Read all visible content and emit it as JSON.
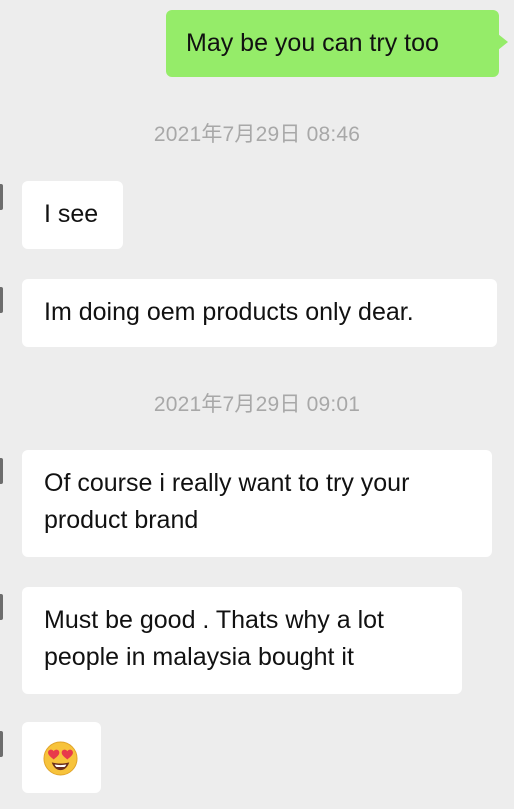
{
  "messages": [
    {
      "type": "outgoing",
      "text": "May be you can try too"
    },
    {
      "type": "timestamp",
      "text": "2021年7月29日 08:46"
    },
    {
      "type": "incoming",
      "text": "I see"
    },
    {
      "type": "incoming",
      "text": "Im doing oem products only dear."
    },
    {
      "type": "timestamp",
      "text": "2021年7月29日 09:01"
    },
    {
      "type": "incoming",
      "text": "Of course i really want to try your product brand"
    },
    {
      "type": "incoming",
      "text": "Must be good . Thats why a lot people in malaysia bought it"
    },
    {
      "type": "incoming_emoji",
      "icon": "heart-eyes-emoji"
    }
  ],
  "colors": {
    "background": "#ededed",
    "outgoing_bubble": "#95ec69",
    "incoming_bubble": "#ffffff",
    "timestamp_text": "#a8a8a8"
  }
}
